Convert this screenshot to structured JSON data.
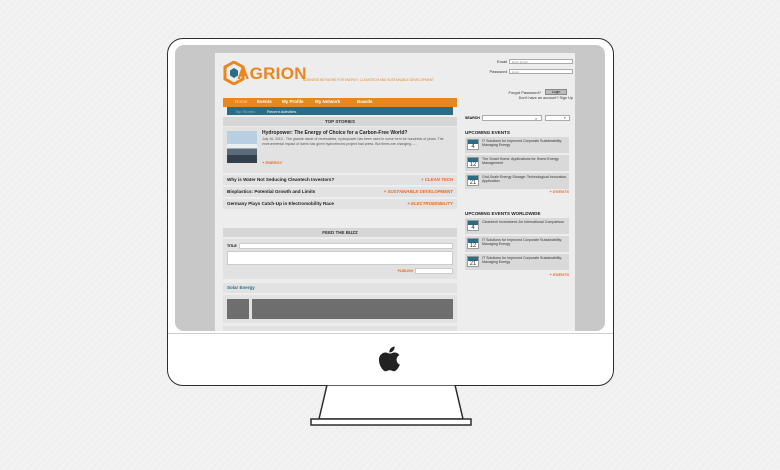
{
  "brand": {
    "logo_text": "AGRION",
    "tagline": "BUSINESS NETWORK FOR ENERGY, CLEANTECH AND SUSTAINABLE DEVELOPMENT",
    "accent": "#e8861f",
    "secondary": "#2a6d87"
  },
  "login": {
    "email_label": "Email",
    "email_placeholder": "Enter Email",
    "password_label": "Password",
    "password_placeholder": "Enter",
    "login_button": "Login",
    "forgot": "Forgot Password?",
    "signup": "Don't have an account? Sign Up"
  },
  "nav": {
    "items": [
      "Home",
      "Events",
      "My Profile",
      "My Network",
      "Boards"
    ],
    "sub_items": [
      "Top Stories",
      "Recent Activities"
    ]
  },
  "top_stories": {
    "heading": "TOP STORIES",
    "feature": {
      "title": "Hydropower: The Energy of Choice for a Carbon-Free World?",
      "body": "July 16, 2010 - The grande dame of renewables, hydropower has been used in some form for hundreds of years. The environmental impact of dams has given hydroelectric project bad press. But times are changing......",
      "tag": "+ ENERGY"
    },
    "headlines": [
      {
        "title": "Why is Water Not Seducing Cleantech Investors?",
        "category": "+ CLEAN TECH"
      },
      {
        "title": "Bioplastics: Potential Growth and Limits",
        "category": "+ SUSTAINABLE DEVELOPMENT"
      },
      {
        "title": "Germany Plays Catch-Up in Electromobility Race",
        "category": "+ ELECTROMOBILITY"
      }
    ]
  },
  "buzz": {
    "heading": "FEED THE BUZZ",
    "title_label": "TITLE",
    "publish_label": "PUBLISH"
  },
  "solar": {
    "label": "Solar Energy"
  },
  "search": {
    "label": "SEARCH"
  },
  "upcoming": {
    "heading": "UPCOMING EVENTS",
    "events": [
      {
        "day": "4",
        "text": "IT Solutions for Improved Corporate Sustainability: Managing Energy"
      },
      {
        "day": "12",
        "text": "The Smart Home: Applications for Home Energy Management"
      },
      {
        "day": "21",
        "text": "Grid-Scale Energy Storage: Technological Innovation, Application"
      }
    ],
    "more": "+ EVENTS"
  },
  "worldwide": {
    "heading": "UPCOMING EVENTS WORLDWIDE",
    "events": [
      {
        "day": "4",
        "text": "Cleantech Investment: An International Comparison"
      },
      {
        "day": "12",
        "text": "IT Solutions for Improved Corporate Sustainability: Managing Energy"
      },
      {
        "day": "21",
        "text": "IT Solutions for Improved Corporate Sustainability: Managing Energy"
      }
    ],
    "more": "+ EVENTS"
  }
}
